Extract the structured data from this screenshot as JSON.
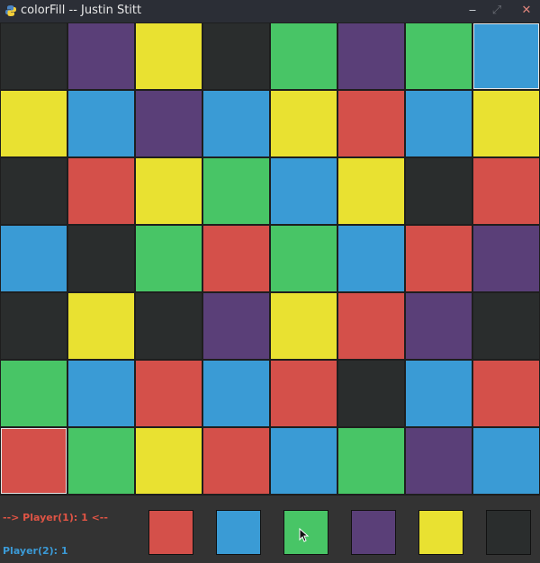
{
  "window": {
    "title": "colorFill -- Justin Stitt",
    "controls": [
      "‒",
      "⤢",
      "✕"
    ]
  },
  "colors": {
    "K": "#2a2d2d",
    "P": "#5a3f78",
    "Y": "#e9e131",
    "G": "#48c566",
    "B": "#3a9bd5",
    "R": "#d4504a"
  },
  "board": [
    [
      "K",
      "P",
      "Y",
      "K",
      "G",
      "P",
      "G",
      "B"
    ],
    [
      "Y",
      "B",
      "P",
      "B",
      "Y",
      "R",
      "B",
      "Y"
    ],
    [
      "K",
      "R",
      "Y",
      "G",
      "B",
      "Y",
      "K",
      "R"
    ],
    [
      "B",
      "K",
      "G",
      "R",
      "G",
      "B",
      "R",
      "P"
    ],
    [
      "K",
      "Y",
      "K",
      "P",
      "Y",
      "R",
      "P",
      "K"
    ],
    [
      "G",
      "B",
      "R",
      "B",
      "R",
      "K",
      "B",
      "R"
    ],
    [
      "R",
      "G",
      "Y",
      "R",
      "B",
      "G",
      "P",
      "B"
    ]
  ],
  "owned_cells": [
    [
      0,
      7
    ],
    [
      6,
      0
    ]
  ],
  "players": {
    "p1": "--> Player(1): 1 <--",
    "p2": "Player(2): 1"
  },
  "choices": [
    "R",
    "B",
    "G",
    "P",
    "Y",
    "K"
  ],
  "icons": {
    "app": "python-icon",
    "cursor": "mouse-cursor-icon"
  }
}
